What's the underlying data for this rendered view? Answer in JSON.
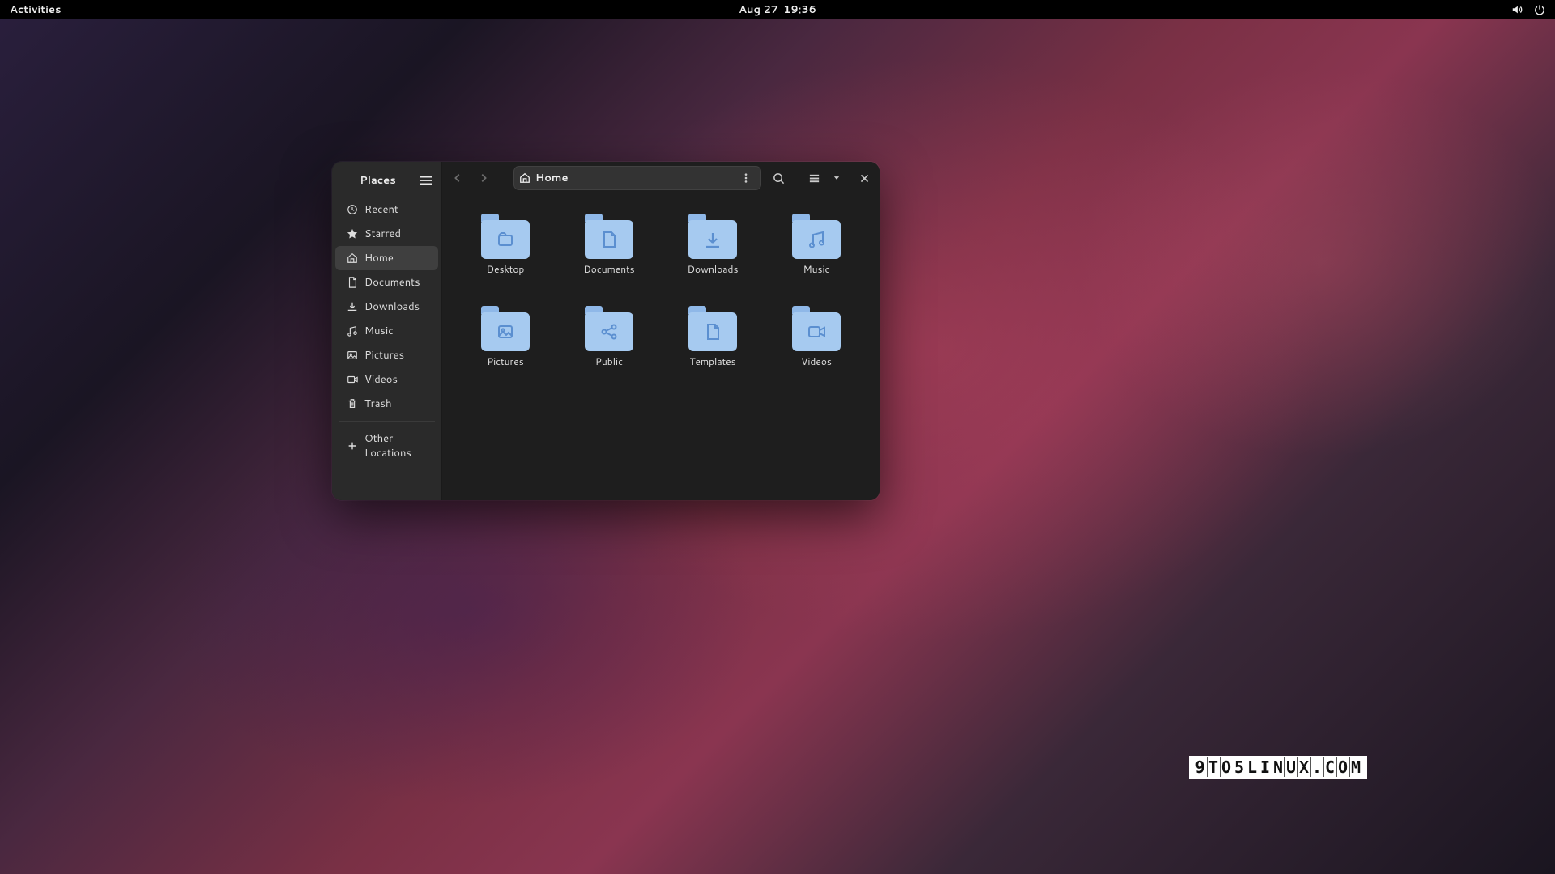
{
  "topbar": {
    "activities": "Activities",
    "date": "Aug 27",
    "time": "19:36"
  },
  "sidebar": {
    "title": "Places",
    "items": [
      {
        "label": "Recent"
      },
      {
        "label": "Starred"
      },
      {
        "label": "Home"
      },
      {
        "label": "Documents"
      },
      {
        "label": "Downloads"
      },
      {
        "label": "Music"
      },
      {
        "label": "Pictures"
      },
      {
        "label": "Videos"
      },
      {
        "label": "Trash"
      }
    ],
    "other": "Other Locations"
  },
  "pathbar": {
    "location": "Home"
  },
  "folders": [
    {
      "name": "Desktop",
      "icon": "folder"
    },
    {
      "name": "Documents",
      "icon": "document"
    },
    {
      "name": "Downloads",
      "icon": "download"
    },
    {
      "name": "Music",
      "icon": "music"
    },
    {
      "name": "Pictures",
      "icon": "picture"
    },
    {
      "name": "Public",
      "icon": "share"
    },
    {
      "name": "Templates",
      "icon": "template"
    },
    {
      "name": "Videos",
      "icon": "video"
    }
  ],
  "watermark": "9TO5LINUX.COM"
}
